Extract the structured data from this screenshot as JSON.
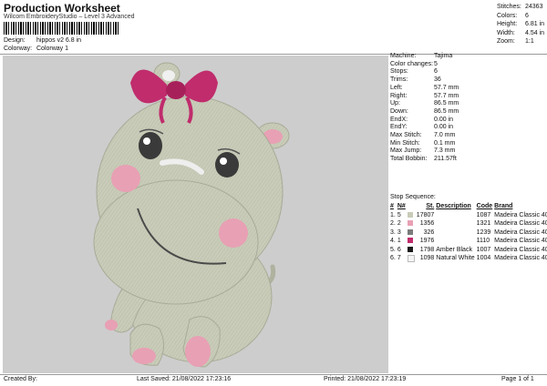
{
  "header": {
    "title": "Production Worksheet",
    "subtitle": "Wilcom EmbroideryStudio – Level 3 Advanced",
    "design_label": "Design:",
    "design_value": "hippos v2 6.8 in",
    "colorway_label": "Colorway:",
    "colorway_value": "Colorway 1"
  },
  "summary": [
    {
      "label": "Stitches:",
      "value": "24363"
    },
    {
      "label": "Colors:",
      "value": "6"
    },
    {
      "label": "Height:",
      "value": "6.81 in"
    },
    {
      "label": "Width:",
      "value": "4.54 in"
    },
    {
      "label": "Zoom:",
      "value": "1:1"
    }
  ],
  "properties": [
    {
      "label": "Machine:",
      "value": "Tajima"
    },
    {
      "label": "Color changes:",
      "value": "5"
    },
    {
      "label": "Stops:",
      "value": "6"
    },
    {
      "label": "Trims:",
      "value": "36"
    },
    {
      "label": "Left:",
      "value": "57.7 mm"
    },
    {
      "label": "Right:",
      "value": "57.7 mm"
    },
    {
      "label": "Up:",
      "value": "86.5 mm"
    },
    {
      "label": "Down:",
      "value": "86.5 mm"
    },
    {
      "label": "EndX:",
      "value": "0.00 in"
    },
    {
      "label": "EndY:",
      "value": "0.00 in"
    },
    {
      "label": "Max Stitch:",
      "value": "7.0 mm"
    },
    {
      "label": "Min Stitch:",
      "value": "0.1 mm"
    },
    {
      "label": "Max Jump:",
      "value": "7.3 mm"
    },
    {
      "label": "Total Bobbin:",
      "value": "211.57ft"
    }
  ],
  "stop_sequence": {
    "title": "Stop Sequence:",
    "headers": [
      "#",
      "N#",
      "St.",
      "Description",
      "Code",
      "Brand"
    ],
    "rows": [
      {
        "num": "1.",
        "n": "5",
        "color": "#c8ccb8",
        "st": "17807",
        "desc": "",
        "code": "1087",
        "brand": "Madeira Classic 40"
      },
      {
        "num": "2.",
        "n": "2",
        "color": "#e8a0b4",
        "st": "1356",
        "desc": "",
        "code": "1321",
        "brand": "Madeira Classic 40"
      },
      {
        "num": "3.",
        "n": "3",
        "color": "#7a7a7a",
        "st": "326",
        "desc": "",
        "code": "1239",
        "brand": "Madeira Classic 40"
      },
      {
        "num": "4.",
        "n": "1",
        "color": "#c02c6c",
        "st": "1976",
        "desc": "",
        "code": "1110",
        "brand": "Madeira Classic 40"
      },
      {
        "num": "5.",
        "n": "6",
        "color": "#1a1a1a",
        "st": "1798",
        "desc": "Amber Black",
        "code": "1007",
        "brand": "Madeira Classic 40"
      },
      {
        "num": "6.",
        "n": "7",
        "color": "#f4f4f4",
        "st": "1098",
        "desc": "Natural White",
        "code": "1004",
        "brand": "Madeira Classic 40"
      }
    ]
  },
  "footer": {
    "created_by": "Created By:",
    "last_saved": "Last Saved: 21/08/2022 17:23:16",
    "printed": "Printed: 21/08/2022 17:23:19",
    "page": "Page 1 of 1"
  },
  "colors": {
    "canvas_bg": "#cdcdcd",
    "body": "#c8ccb8",
    "bow": "#c02c6c",
    "cheek": "#e8a0b4"
  }
}
